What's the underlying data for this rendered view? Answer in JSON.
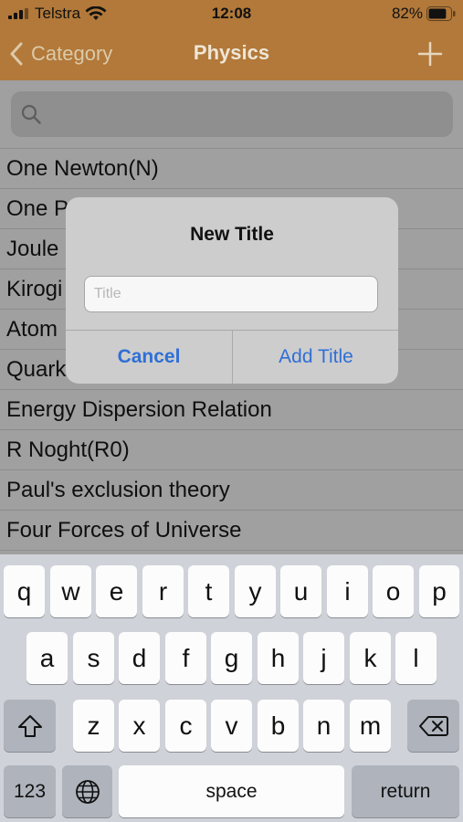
{
  "status_bar": {
    "carrier": "Telstra",
    "time": "12:08",
    "battery": "82%",
    "battery_level": 0.82
  },
  "nav": {
    "back_label": "Category",
    "title": "Physics",
    "add_icon": "plus-icon"
  },
  "search": {
    "icon": "search-icon",
    "placeholder": ""
  },
  "list": {
    "items": [
      "One Newton(N)",
      "One P",
      "Joule",
      "Kirogi",
      "Atom",
      "Quark",
      "Energy Dispersion Relation",
      "R Noght(R0)",
      "Paul's exclusion theory",
      "Four Forces of Universe"
    ]
  },
  "alert": {
    "title": "New Title",
    "input_placeholder": "Title",
    "input_value": "",
    "cancel_label": "Cancel",
    "add_label": "Add Title"
  },
  "keyboard": {
    "row1": [
      "q",
      "w",
      "e",
      "r",
      "t",
      "y",
      "u",
      "i",
      "o",
      "p"
    ],
    "row2": [
      "a",
      "s",
      "d",
      "f",
      "g",
      "h",
      "j",
      "k",
      "l"
    ],
    "row3": [
      "z",
      "x",
      "c",
      "v",
      "b",
      "n",
      "m"
    ],
    "numbers_label": "123",
    "space_label": "space",
    "return_label": "return",
    "shift_icon": "shift-icon",
    "delete_icon": "delete-icon",
    "globe_icon": "globe-icon"
  }
}
